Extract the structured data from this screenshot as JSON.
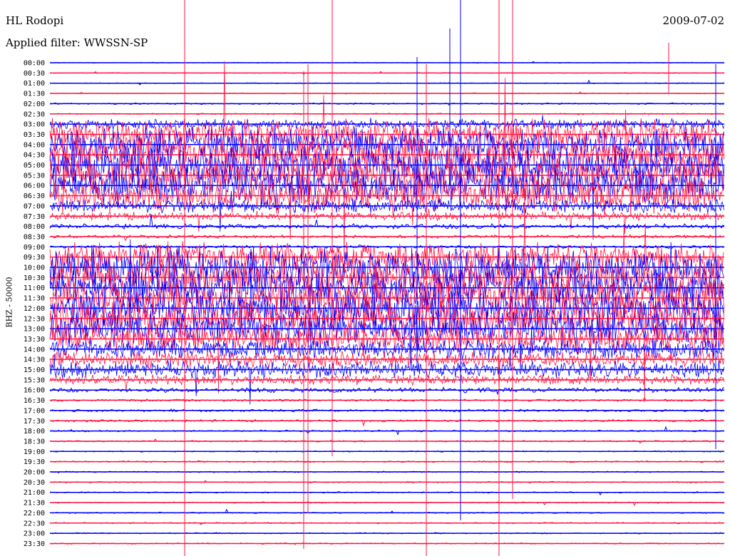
{
  "station": "HL Rodopi",
  "date": "2009-07-02",
  "filter_line": "Applied filter: WWSSN-SP",
  "channel_label": "BHZ - 50000",
  "colors": {
    "odd": "#0000ff",
    "even": "#ff1744"
  },
  "chart_data": {
    "type": "line",
    "title": "HL Rodopi",
    "subtitle": "Applied filter: WWSSN-SP",
    "ylabel": "BHZ - 50000",
    "tick_labels": [
      "00:00",
      "00:30",
      "01:00",
      "01:30",
      "02:00",
      "02:30",
      "03:00",
      "03:30",
      "04:00",
      "04:30",
      "05:00",
      "05:30",
      "06:00",
      "06:30",
      "07:00",
      "07:30",
      "08:00",
      "08:30",
      "09:00",
      "09:30",
      "10:00",
      "10:30",
      "11:00",
      "11:30",
      "12:00",
      "12:30",
      "13:00",
      "13:30",
      "14:00",
      "14:30",
      "15:00",
      "15:30",
      "16:00",
      "16:30",
      "17:00",
      "17:30",
      "18:00",
      "18:30",
      "19:00",
      "19:30",
      "20:00",
      "20:30",
      "21:00",
      "21:30",
      "22:00",
      "22:30",
      "23:00",
      "23:30"
    ],
    "trace_minutes": 30,
    "noise_level": [
      0.5,
      0.5,
      0.6,
      0.6,
      1.0,
      0.8,
      6,
      18,
      22,
      24,
      24,
      24,
      24,
      22,
      8,
      5,
      3,
      2,
      2,
      18,
      24,
      24,
      24,
      24,
      24,
      24,
      22,
      18,
      12,
      10,
      10,
      6,
      3,
      1.5,
      1.5,
      1.5,
      1,
      1,
      0.8,
      1,
      0.8,
      0.8,
      0.8,
      0.8,
      0.8,
      0.8,
      0.8,
      0.8
    ],
    "grid": false
  }
}
